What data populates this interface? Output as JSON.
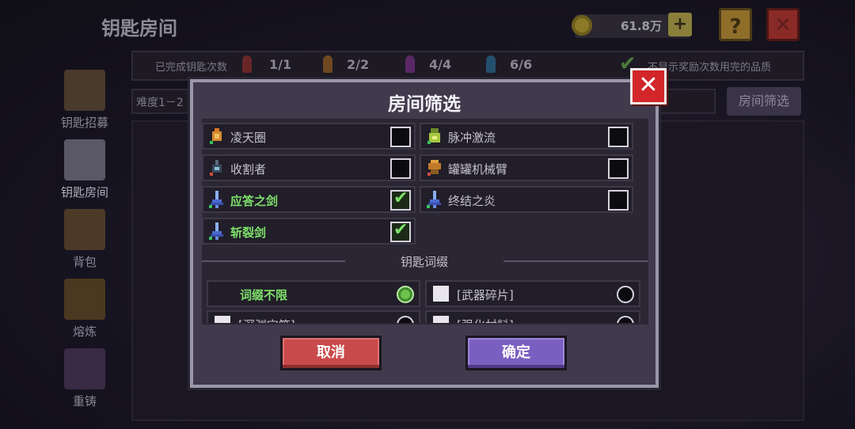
{
  "background": {
    "title": "钥匙房间",
    "coins": "61.8万",
    "plus": "+",
    "help": "?",
    "close": "✕",
    "completed_label": "已完成钥匙次数",
    "key_counts": [
      "1/1",
      "2/2",
      "4/4",
      "6/6"
    ],
    "key_colors": [
      "#b8383a",
      "#c07a2a",
      "#a040b0",
      "#3a8ac0"
    ],
    "hide_label": "不显示奖励次数用完的品质",
    "difficulty": "难度1－2",
    "filter_button": "房间筛选",
    "sidebar": [
      "钥匙招募",
      "钥匙房间",
      "背包",
      "熔炼",
      "重铸"
    ]
  },
  "modal": {
    "title": "房间筛选",
    "close": "✕",
    "items": [
      {
        "label": "凌天圈",
        "checked": false,
        "icon": "ring-weapon-icon"
      },
      {
        "label": "脉冲激流",
        "checked": false,
        "icon": "pulse-gun-icon"
      },
      {
        "label": "收割者",
        "checked": false,
        "icon": "reaper-icon"
      },
      {
        "label": "罐罐机械臂",
        "checked": false,
        "icon": "mech-arm-icon"
      },
      {
        "label": "应答之剑",
        "checked": true,
        "icon": "sword-icon"
      },
      {
        "label": "终结之炎",
        "checked": false,
        "icon": "flame-sword-icon"
      },
      {
        "label": "斩裂剑",
        "checked": true,
        "icon": "sword-icon"
      }
    ],
    "section_label": "钥匙词缀",
    "affixes": [
      {
        "label": "词缀不限",
        "selected": true
      },
      {
        "label": "[武器碎片]",
        "selected": false
      },
      {
        "label": "[深渊宝箱]",
        "selected": false
      },
      {
        "label": "[强化材料]",
        "selected": false
      }
    ],
    "cancel": "取消",
    "confirm": "确定"
  }
}
